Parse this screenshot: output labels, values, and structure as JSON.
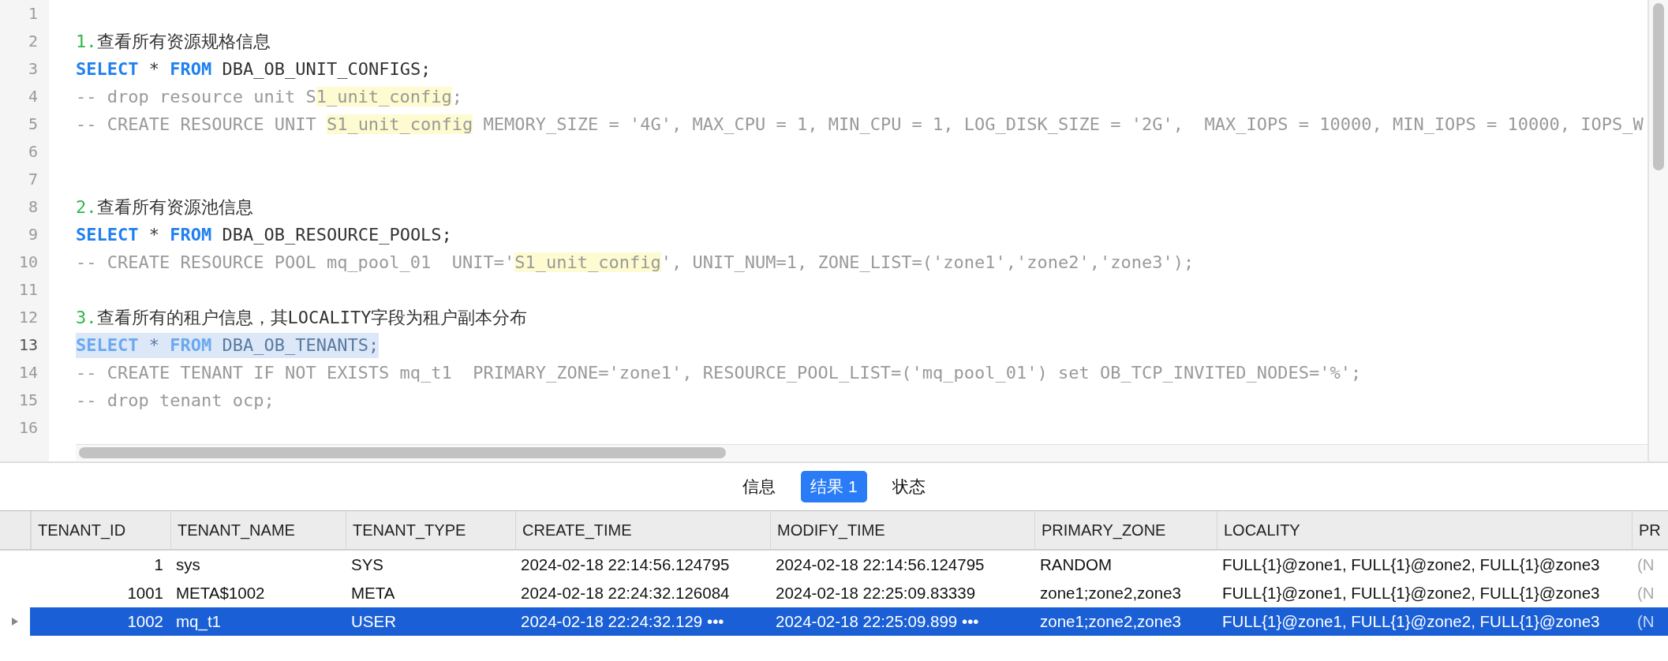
{
  "editor": {
    "lines": [
      {
        "number": "1",
        "selected": false
      },
      {
        "number": "2",
        "selected": false,
        "tokens": [
          {
            "text": "1.",
            "kind": "number"
          },
          {
            "text": "查看所有资源规格信息",
            "kind": "plain"
          }
        ]
      },
      {
        "number": "3",
        "selected": false,
        "tokens": [
          {
            "text": "SELECT",
            "kind": "keyword"
          },
          {
            "text": " * ",
            "kind": "plain"
          },
          {
            "text": "FROM",
            "kind": "keyword"
          },
          {
            "text": " DBA_OB_UNIT_CONFIGS;",
            "kind": "plain"
          }
        ]
      },
      {
        "number": "4",
        "selected": false,
        "tokens": [
          {
            "text": "-- drop resource unit S",
            "kind": "comment"
          },
          {
            "text": "1_unit_config",
            "kind": "highlight"
          },
          {
            "text": ";",
            "kind": "comment"
          }
        ]
      },
      {
        "number": "5",
        "selected": false,
        "tokens": [
          {
            "text": "-- CREATE RESOURCE UNIT ",
            "kind": "comment"
          },
          {
            "text": "S1_unit_config",
            "kind": "highlight"
          },
          {
            "text": " MEMORY_SIZE = '4G', MAX_CPU = 1, MIN_CPU = 1, LOG_DISK_SIZE = '2G',  MAX_IOPS = 10000, MIN_IOPS = 10000, IOPS_W",
            "kind": "comment"
          }
        ]
      },
      {
        "number": "6",
        "selected": false
      },
      {
        "number": "7",
        "selected": false
      },
      {
        "number": "8",
        "selected": false,
        "tokens": [
          {
            "text": "2.",
            "kind": "number"
          },
          {
            "text": "查看所有资源池信息",
            "kind": "plain"
          }
        ]
      },
      {
        "number": "9",
        "selected": false,
        "tokens": [
          {
            "text": "SELECT",
            "kind": "keyword"
          },
          {
            "text": " * ",
            "kind": "plain"
          },
          {
            "text": "FROM",
            "kind": "keyword"
          },
          {
            "text": " DBA_OB_RESOURCE_POOLS;",
            "kind": "plain"
          }
        ]
      },
      {
        "number": "10",
        "selected": false,
        "tokens": [
          {
            "text": "-- CREATE RESOURCE POOL mq_pool_01  UNIT='",
            "kind": "comment"
          },
          {
            "text": "S1_unit_config",
            "kind": "highlight"
          },
          {
            "text": "', UNIT_NUM=1, ZONE_LIST=('zone1','zone2','zone3');",
            "kind": "comment"
          }
        ]
      },
      {
        "number": "11",
        "selected": false
      },
      {
        "number": "12",
        "selected": false,
        "tokens": [
          {
            "text": "3.",
            "kind": "number"
          },
          {
            "text": "查看所有的租户信息，其LOCALITY字段为租户副本分布",
            "kind": "plain"
          }
        ]
      },
      {
        "number": "13",
        "selected": true,
        "tokens": [
          {
            "text": "SELECT",
            "kind": "keyword"
          },
          {
            "text": " * ",
            "kind": "plain"
          },
          {
            "text": "FROM",
            "kind": "keyword"
          },
          {
            "text": " DBA_OB_TENANTS;",
            "kind": "plain"
          }
        ]
      },
      {
        "number": "14",
        "selected": false,
        "tokens": [
          {
            "text": "-- CREATE TENANT IF NOT EXISTS mq_t1  PRIMARY_ZONE='zone1', RESOURCE_POOL_LIST=('mq_pool_01') set OB_TCP_INVITED_NODES='%';",
            "kind": "comment"
          }
        ]
      },
      {
        "number": "15",
        "selected": false,
        "tokens": [
          {
            "text": "-- drop tenant ocp;",
            "kind": "comment"
          }
        ]
      },
      {
        "number": "16",
        "selected": false
      }
    ]
  },
  "tabs": [
    {
      "label": "信息",
      "selected": false
    },
    {
      "label": "结果 1",
      "selected": true
    },
    {
      "label": "状态",
      "selected": false
    }
  ],
  "table": {
    "columns": [
      "TENANT_ID",
      "TENANT_NAME",
      "TENANT_TYPE",
      "CREATE_TIME",
      "MODIFY_TIME",
      "PRIMARY_ZONE",
      "LOCALITY",
      "PR"
    ],
    "rows": [
      {
        "selected": false,
        "cells": [
          "1",
          "sys",
          "SYS",
          "2024-02-18 22:14:56.124795",
          "2024-02-18 22:14:56.124795",
          "RANDOM",
          "FULL{1}@zone1, FULL{1}@zone2, FULL{1}@zone3",
          "(N"
        ]
      },
      {
        "selected": false,
        "cells": [
          "1001",
          "META$1002",
          "META",
          "2024-02-18 22:24:32.126084",
          "2024-02-18 22:25:09.83339",
          "zone1;zone2,zone3",
          "FULL{1}@zone1, FULL{1}@zone2, FULL{1}@zone3",
          "(N"
        ]
      },
      {
        "selected": true,
        "cells": [
          "1002",
          "mq_t1",
          "USER",
          "2024-02-18 22:24:32.129 •••",
          "2024-02-18 22:25:09.899 •••",
          "zone1;zone2,zone3",
          "FULL{1}@zone1, FULL{1}@zone2, FULL{1}@zone3",
          "(N"
        ]
      }
    ]
  }
}
